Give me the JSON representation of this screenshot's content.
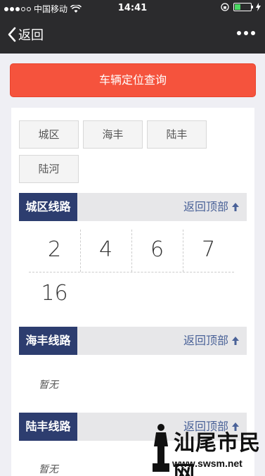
{
  "status_bar": {
    "carrier": "中国移动",
    "time": "14:41",
    "battery_level": 0.35,
    "battery_color": "#4cd964"
  },
  "nav": {
    "back_label": "返回",
    "back_icon": "chevron-left-icon",
    "more_icon": "more-dots-icon"
  },
  "query_button": {
    "label": "车辆定位查询",
    "color": "#f5533d"
  },
  "areas": [
    "城区",
    "海丰",
    "陆丰",
    "陆河"
  ],
  "sections": [
    {
      "title": "城区线路",
      "back_top": "返回顶部",
      "routes": [
        "2",
        "4",
        "6",
        "7",
        "16"
      ]
    },
    {
      "title": "海丰线路",
      "back_top": "返回顶部",
      "empty": "暂无"
    },
    {
      "title": "陆丰线路",
      "back_top": "返回顶部",
      "empty": "暂无"
    }
  ],
  "watermark": {
    "text": "汕尾市民网",
    "url": "www.swsm.net"
  },
  "colors": {
    "header": "#2b2b2d",
    "section_title": "#2d3d6f",
    "back_top_link": "#4a6298"
  }
}
